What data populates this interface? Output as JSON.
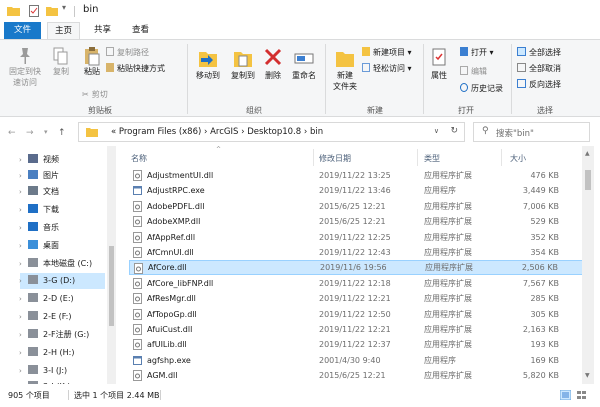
{
  "title_bar": {
    "title": "bin"
  },
  "tabs": [
    {
      "label": "文件"
    },
    {
      "label": "主页"
    },
    {
      "label": "共享"
    },
    {
      "label": "查看"
    }
  ],
  "ribbon": {
    "clipboard": {
      "pin": "固定到快速访问",
      "pin_l1": "固定到快",
      "pin_l2": "速访问",
      "copy": "复制",
      "paste": "粘贴",
      "copy_path": "复制路径",
      "paste_shortcut": "粘贴快捷方式",
      "cut": "剪切",
      "group": "剪贴板"
    },
    "organize": {
      "move_to": "移动到",
      "copy_to": "复制到",
      "delete": "删除",
      "rename": "重命名",
      "group": "组织"
    },
    "new": {
      "new_folder_l1": "新建",
      "new_folder_l2": "文件夹",
      "new_item": "新建项目",
      "easy_access": "轻松访问",
      "group": "新建"
    },
    "open": {
      "properties": "属性",
      "open": "打开",
      "edit": "编辑",
      "history": "历史记录",
      "group": "打开"
    },
    "select": {
      "select_all": "全部选择",
      "select_none": "全部取消",
      "invert": "反向选择",
      "group": "选择"
    }
  },
  "address": {
    "crumbs": "« Program Files (x86) › ArcGIS › Desktop10.8 › bin",
    "search_placeholder": "搜索\"bin\""
  },
  "nav": [
    {
      "label": "视频",
      "icon": "video-icon"
    },
    {
      "label": "图片",
      "icon": "pictures-icon"
    },
    {
      "label": "文档",
      "icon": "documents-icon"
    },
    {
      "label": "下载",
      "icon": "downloads-icon"
    },
    {
      "label": "音乐",
      "icon": "music-icon"
    },
    {
      "label": "桌面",
      "icon": "desktop-icon"
    },
    {
      "label": "本地磁盘 (C:)",
      "icon": "drive-icon"
    },
    {
      "label": "3-G (D:)",
      "icon": "drive-icon"
    },
    {
      "label": "2-D (E:)",
      "icon": "drive-icon"
    },
    {
      "label": "2-E (F:)",
      "icon": "drive-icon"
    },
    {
      "label": "2-F注册 (G:)",
      "icon": "drive-icon"
    },
    {
      "label": "2-H (H:)",
      "icon": "drive-icon"
    },
    {
      "label": "3-I (J:)",
      "icon": "drive-icon"
    },
    {
      "label": "3-J (K:)",
      "icon": "drive-icon"
    }
  ],
  "columns": {
    "name": "名称",
    "date": "修改日期",
    "type": "类型",
    "size": "大小"
  },
  "files": [
    {
      "name": "AdjustmentUI.dll",
      "date": "2019/11/22 13:25",
      "type": "应用程序扩展",
      "size": "476 KB"
    },
    {
      "name": "AdjustRPC.exe",
      "date": "2019/11/22 13:46",
      "type": "应用程序",
      "size": "3,449 KB"
    },
    {
      "name": "AdobePDFL.dll",
      "date": "2015/6/25 12:21",
      "type": "应用程序扩展",
      "size": "7,006 KB"
    },
    {
      "name": "AdobeXMP.dll",
      "date": "2015/6/25 12:21",
      "type": "应用程序扩展",
      "size": "529 KB"
    },
    {
      "name": "AfAppRef.dll",
      "date": "2019/11/22 12:25",
      "type": "应用程序扩展",
      "size": "352 KB"
    },
    {
      "name": "AfCmnUI.dll",
      "date": "2019/11/22 12:43",
      "type": "应用程序扩展",
      "size": "354 KB"
    },
    {
      "name": "AfCore.dll",
      "date": "2019/11/6 19:56",
      "type": "应用程序扩展",
      "size": "2,506 KB"
    },
    {
      "name": "AfCore_libFNP.dll",
      "date": "2019/11/22 12:18",
      "type": "应用程序扩展",
      "size": "7,567 KB"
    },
    {
      "name": "AfResMgr.dll",
      "date": "2019/11/22 12:21",
      "type": "应用程序扩展",
      "size": "285 KB"
    },
    {
      "name": "AfTopoGp.dll",
      "date": "2019/11/22 12:50",
      "type": "应用程序扩展",
      "size": "305 KB"
    },
    {
      "name": "AfuiCust.dll",
      "date": "2019/11/22 12:21",
      "type": "应用程序扩展",
      "size": "2,163 KB"
    },
    {
      "name": "afUILib.dll",
      "date": "2019/11/22 12:37",
      "type": "应用程序扩展",
      "size": "193 KB"
    },
    {
      "name": "agfshp.exe",
      "date": "2001/4/30 9:40",
      "type": "应用程序",
      "size": "169 KB"
    },
    {
      "name": "AGM.dll",
      "date": "2015/6/25 12:21",
      "type": "应用程序扩展",
      "size": "5,820 KB"
    }
  ],
  "selected_index": 6,
  "status": {
    "count": "905 个项目",
    "selection": "选中 1 个项目  2.44 MB"
  },
  "colors": {
    "file_tab": "#1979ca",
    "selection": "#cce8ff",
    "selection_border": "#99d1ff",
    "folder": "#f4c342"
  }
}
